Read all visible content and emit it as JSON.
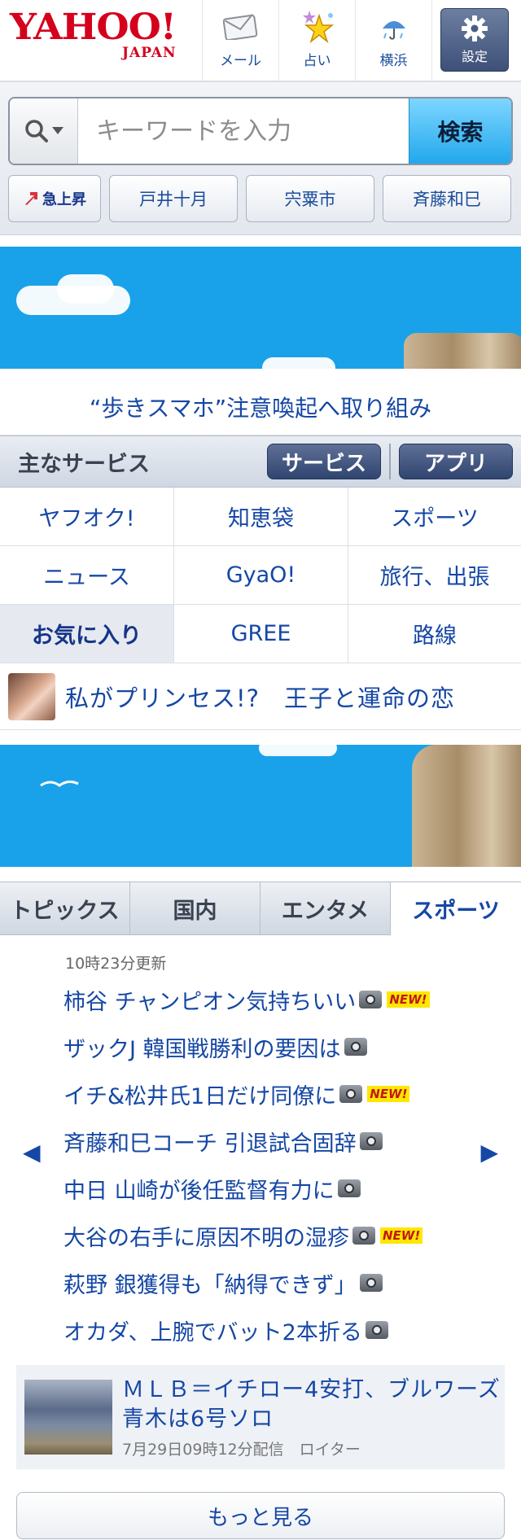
{
  "header": {
    "logo_text": "YAHOO!",
    "logo_sub": "JAPAN",
    "nav": [
      {
        "label": "メール",
        "icon": "mail-icon"
      },
      {
        "label": "占い",
        "icon": "fortune-star-icon"
      },
      {
        "label": "横浜",
        "icon": "weather-umbrella-icon"
      }
    ],
    "settings_label": "設定"
  },
  "search": {
    "placeholder": "キーワードを入力",
    "submit_label": "検索",
    "trending_label": "急上昇",
    "keywords": [
      "戸井十月",
      "宍粟市",
      "斉藤和巳"
    ]
  },
  "headline": "“歩きスマホ”注意喚起へ取り組み",
  "services": {
    "title": "主なサービス",
    "tabs": [
      "サービス",
      "アプリ"
    ],
    "items": [
      "ヤフオク!",
      "知恵袋",
      "スポーツ",
      "ニュース",
      "GyaO!",
      "旅行、出張",
      "お気に入り",
      "GREE",
      "路線"
    ]
  },
  "promo": {
    "text": "私がプリンセス!?　王子と運命の恋"
  },
  "topics": {
    "tabs": [
      "トピックス",
      "国内",
      "エンタメ",
      "スポーツ"
    ],
    "active_tab": "スポーツ",
    "updated": "10時23分更新",
    "new_badge": "NEW!",
    "items": [
      {
        "title": "柿谷 チャンピオン気持ちいい",
        "photo": true,
        "new": true
      },
      {
        "title": "ザックJ 韓国戦勝利の要因は",
        "photo": true,
        "new": false
      },
      {
        "title": "イチ&松井氏1日だけ同僚に",
        "photo": true,
        "new": true
      },
      {
        "title": "斉藤和巳コーチ 引退試合固辞",
        "photo": true,
        "new": false
      },
      {
        "title": "中日 山崎が後任監督有力に",
        "photo": true,
        "new": false
      },
      {
        "title": "大谷の右手に原因不明の湿疹",
        "photo": true,
        "new": true
      },
      {
        "title": "萩野 銀獲得も「納得できず」",
        "photo": true,
        "new": false
      },
      {
        "title": "オカダ、上腕でバット2本折る",
        "photo": true,
        "new": false
      }
    ],
    "featured": {
      "title": "ＭＬＢ＝イチロー4安打、ブルワーズ青木は6号ソロ",
      "meta": "7月29日09時12分配信　ロイター"
    },
    "more_label": "もっと見る"
  },
  "colors": {
    "link": "#1547a5",
    "brand": "#d5001c",
    "sky": "#19a2ea",
    "search_button": "#22a8ec"
  }
}
